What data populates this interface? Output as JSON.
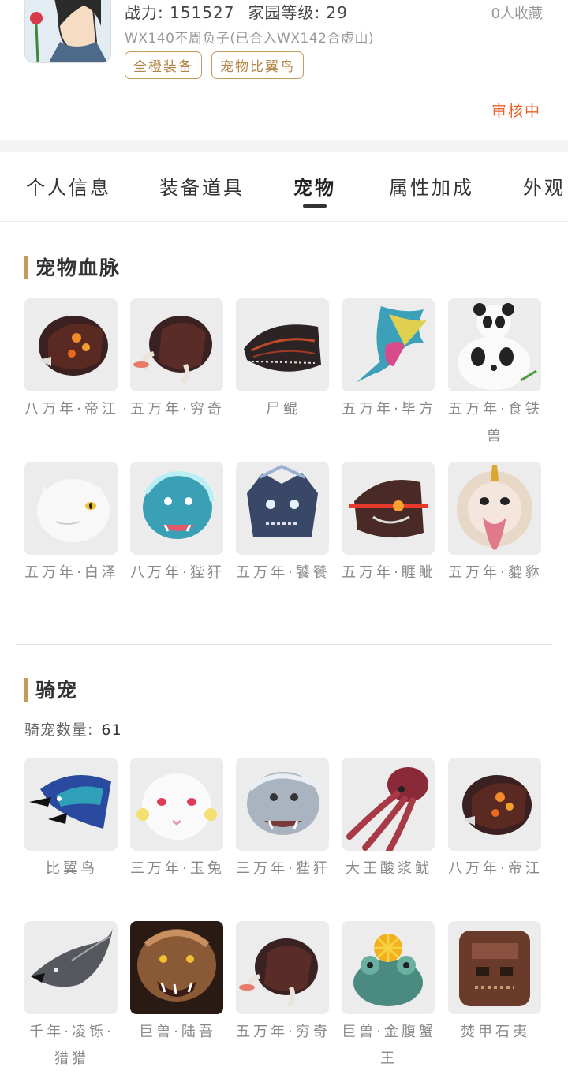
{
  "profile": {
    "stats": "战力: 151527",
    "home_level": "家园等级: 29",
    "favorites": "0人收藏",
    "server": "WX140不周负子(已合入WX142合虚山)",
    "tags": [
      "全橙装备",
      "宠物比翼鸟"
    ],
    "review_status": "审核中"
  },
  "tabs": [
    "个人信息",
    "装备道具",
    "宠物",
    "属性加成",
    "外观"
  ],
  "active_tab": "宠物",
  "bloodline": {
    "title": "宠物血脉",
    "items": [
      {
        "name": "八万年·帝江",
        "icon": "red-dragon-head"
      },
      {
        "name": "五万年·穷奇",
        "icon": "tusked-beast-head"
      },
      {
        "name": "尸鲲",
        "icon": "dark-fish-head"
      },
      {
        "name": "五万年·毕方",
        "icon": "phoenix-bird-head"
      },
      {
        "name": "五万年·食铁兽",
        "icon": "panda"
      },
      {
        "name": "五万年·白泽",
        "icon": "white-cat-head"
      },
      {
        "name": "八万年·狴犴",
        "icon": "blue-beast-head"
      },
      {
        "name": "五万年·饕餮",
        "icon": "armored-beast-head"
      },
      {
        "name": "五万年·睚眦",
        "icon": "red-eyed-dragon"
      },
      {
        "name": "五万年·貔貅",
        "icon": "lion-head"
      }
    ]
  },
  "mounts": {
    "title": "骑宠",
    "count_label": "骑宠数量:",
    "count": "61",
    "items": [
      {
        "name": "比翼鸟",
        "icon": "blue-bird-heads"
      },
      {
        "name": "三万年·玉兔",
        "icon": "white-rabbit"
      },
      {
        "name": "三万年·狴犴",
        "icon": "silver-beast-head"
      },
      {
        "name": "大王酸浆鱿",
        "icon": "red-squid"
      },
      {
        "name": "八万年·帝江",
        "icon": "red-dragon-head"
      },
      {
        "name": "千年·凌铄·猎猎",
        "icon": "grey-bird-head"
      },
      {
        "name": "巨兽·陆吾",
        "icon": "tiger-beast"
      },
      {
        "name": "五万年·穷奇",
        "icon": "tusked-beast-head"
      },
      {
        "name": "巨兽·金腹蟹王",
        "icon": "crab-king"
      },
      {
        "name": "焚甲石夷",
        "icon": "stone-totem"
      }
    ]
  },
  "colors": {
    "accent": "#c59a5c",
    "review": "#e8632c"
  }
}
